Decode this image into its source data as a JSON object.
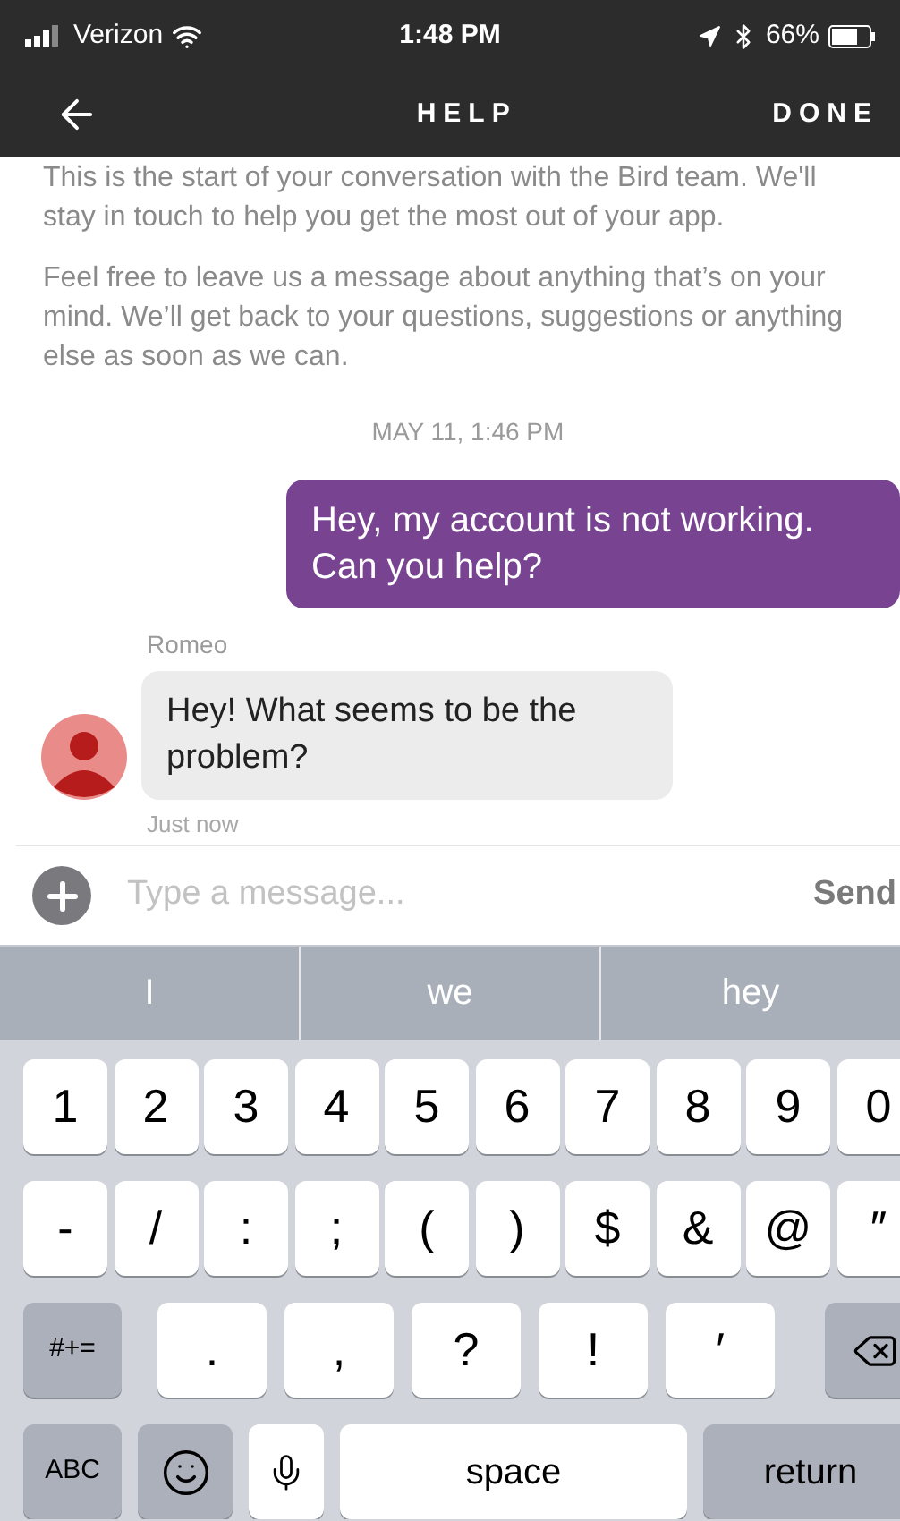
{
  "status_bar": {
    "carrier": "Verizon",
    "time": "1:48 PM",
    "battery": "66%"
  },
  "nav": {
    "title": "HELP",
    "action": "DONE"
  },
  "intro": [
    "This is the start of your conversation with the Bird team. We'll stay in touch to help you get the most out of your app.",
    "Feel free to leave us a message about anything that’s on your mind. We’ll get back to your questions, suggestions or anything else as soon as we can."
  ],
  "date": "MAY 11, 1:46 PM",
  "messages": [
    {
      "kind": "outgoing",
      "text": "Hey, my account is not working. Can you help?"
    },
    {
      "kind": "incoming",
      "sender": "Romeo",
      "text": "Hey! What seems to be the problem?",
      "time": "Just now"
    }
  ],
  "composer": {
    "placeholder": "Type a message...",
    "send": "Send"
  },
  "suggestions": [
    "I",
    "we",
    "hey"
  ],
  "keyboard_rows": [
    [
      {
        "kind": "char",
        "label": "1"
      },
      {
        "kind": "char",
        "label": "2"
      },
      {
        "kind": "char",
        "label": "3"
      },
      {
        "kind": "char",
        "label": "4"
      },
      {
        "kind": "char",
        "label": "5"
      },
      {
        "kind": "char",
        "label": "6"
      },
      {
        "kind": "char",
        "label": "7"
      },
      {
        "kind": "char",
        "label": "8"
      },
      {
        "kind": "char",
        "label": "9"
      },
      {
        "kind": "char",
        "label": "0"
      }
    ],
    [
      {
        "kind": "char",
        "label": "-"
      },
      {
        "kind": "char",
        "label": "/"
      },
      {
        "kind": "char",
        "label": ":"
      },
      {
        "kind": "char",
        "label": ";"
      },
      {
        "kind": "char",
        "label": "("
      },
      {
        "kind": "char",
        "label": ")"
      },
      {
        "kind": "char",
        "label": "$"
      },
      {
        "kind": "char",
        "label": "&"
      },
      {
        "kind": "char",
        "label": "@"
      },
      {
        "kind": "char",
        "label": "″"
      }
    ],
    [
      {
        "kind": "mode",
        "label": "#+="
      },
      {
        "kind": "punct",
        "label": "."
      },
      {
        "kind": "punct",
        "label": ","
      },
      {
        "kind": "punct",
        "label": "?"
      },
      {
        "kind": "punct",
        "label": "!"
      },
      {
        "kind": "punct",
        "label": "′"
      },
      {
        "kind": "backspace"
      }
    ],
    [
      {
        "kind": "mode",
        "label": "ABC"
      },
      {
        "kind": "emoji"
      },
      {
        "kind": "mic"
      },
      {
        "kind": "space",
        "label": "space"
      },
      {
        "kind": "return",
        "label": "return"
      }
    ]
  ]
}
